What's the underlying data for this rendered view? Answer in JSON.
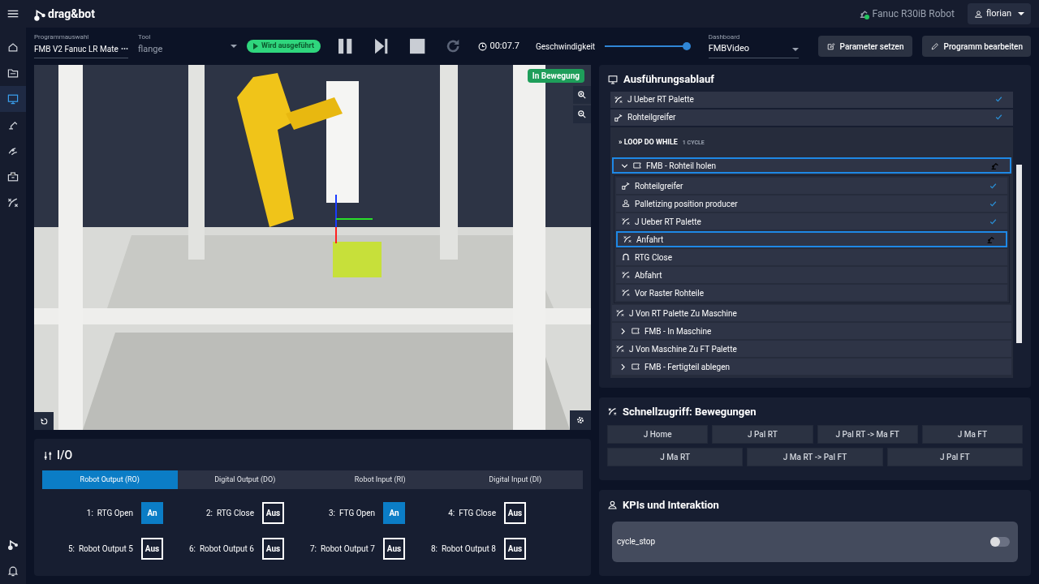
{
  "topbar": {
    "logo": "drag&bot",
    "robot": "Fanuc R30iB Robot",
    "robot_online": true,
    "user": "florian"
  },
  "sidebar": {
    "items": [
      {
        "selected": false
      },
      {
        "selected": false
      },
      {
        "selected": true
      },
      {
        "selected": false
      },
      {
        "selected": false
      },
      {
        "selected": false
      },
      {
        "selected": false
      }
    ]
  },
  "toolbar": {
    "program": {
      "label": "Programmauswahl",
      "value": "FMB V2 Fanuc LR Mate",
      "more": "•••"
    },
    "tool": {
      "label": "Tool",
      "value": "flange"
    },
    "status": "Wird ausgeführt",
    "timer": "00:07.7",
    "speed": {
      "label": "Geschwindigkeit",
      "level": 1.0
    },
    "dashboard": {
      "label": "Dashboard",
      "value": "FMBVideo"
    },
    "buttons": [
      "Parameter setzen",
      "Programm bearbeiten"
    ]
  },
  "viewport": {
    "kind": "picture",
    "badge": "In Bewegung"
  },
  "io": {
    "title": "I/O",
    "tabs": [
      {
        "label": "Robot Output (RO)",
        "selected": true
      },
      {
        "label": "Digital Output (DO)",
        "selected": false
      },
      {
        "label": "Robot Input (RI)",
        "selected": false
      },
      {
        "label": "Digital Input (DI)",
        "selected": false
      }
    ],
    "outputs": [
      {
        "label": "1:  RTG Open",
        "value": "An",
        "on": true
      },
      {
        "label": "2:  RTG Close",
        "value": "Aus",
        "on": false
      },
      {
        "label": "3:  FTG Open",
        "value": "An",
        "on": true
      },
      {
        "label": "4:  FTG Close",
        "value": "Aus",
        "on": false
      },
      {
        "label": "5:  Robot Output 5",
        "value": "Aus",
        "on": false
      },
      {
        "label": "6:  Robot Output 6",
        "value": "Aus",
        "on": false
      },
      {
        "label": "7:  Robot Output 7",
        "value": "Aus",
        "on": false
      },
      {
        "label": "8:  Robot Output 8",
        "value": "Aus",
        "on": false
      }
    ]
  },
  "execution": {
    "title": "Ausführungsablauf",
    "steps": [
      {
        "kind": "motion",
        "label": "J Ueber RT Palette",
        "done": true,
        "running": false,
        "selected": false
      },
      {
        "kind": "gripper",
        "label": "Rohteilgreifer",
        "done": true,
        "running": false,
        "selected": false
      },
      {
        "kind": "loop",
        "label": "» LOOP DO WHILE",
        "meta": "1 CYCLE",
        "children": [
          {
            "kind": "block",
            "label": "FMB - Rohteil holen",
            "expanded": true,
            "done": false,
            "running": true,
            "selected": true,
            "children": [
              {
                "kind": "gripper",
                "label": "Rohteilgreifer",
                "done": true,
                "running": false,
                "selected": false
              },
              {
                "kind": "palletizing",
                "label": "Palletizing position producer",
                "done": true,
                "running": false,
                "selected": false
              },
              {
                "kind": "motion",
                "label": "J Ueber RT Palette",
                "done": true,
                "running": false,
                "selected": false
              },
              {
                "kind": "motion",
                "label": "Anfahrt",
                "done": false,
                "running": true,
                "selected": true
              },
              {
                "kind": "gripper_close",
                "label": "RTG Close",
                "done": false,
                "running": false,
                "selected": false
              },
              {
                "kind": "motion",
                "label": "Abfahrt",
                "done": false,
                "running": false,
                "selected": false
              },
              {
                "kind": "motion",
                "label": "Vor Raster Rohteile",
                "done": false,
                "running": false,
                "selected": false
              }
            ]
          },
          {
            "kind": "motion",
            "label": "J Von RT Palette Zu Maschine",
            "done": false,
            "running": false,
            "selected": false
          },
          {
            "kind": "block",
            "label": "FMB - In Maschine",
            "expanded": false,
            "done": false,
            "running": false,
            "selected": false
          },
          {
            "kind": "motion",
            "label": "J Von Maschine Zu FT Palette",
            "done": false,
            "running": false,
            "selected": false
          },
          {
            "kind": "block",
            "label": "FMB - Fertigteil ablegen",
            "expanded": false,
            "done": false,
            "running": false,
            "selected": false
          }
        ]
      }
    ]
  },
  "quick_access": {
    "title": "Schnellzugriff: Bewegungen",
    "rows": [
      [
        "J Home",
        "J Pal RT",
        "J Pal RT -> Ma FT",
        "J Ma FT"
      ],
      [
        "J Ma RT",
        "J Ma RT -> Pal FT",
        "J Pal FT"
      ]
    ]
  },
  "kpis": {
    "title": "KPIs und Interaktion",
    "toggles": [
      {
        "label": "cycle_stop",
        "on": false
      }
    ]
  }
}
